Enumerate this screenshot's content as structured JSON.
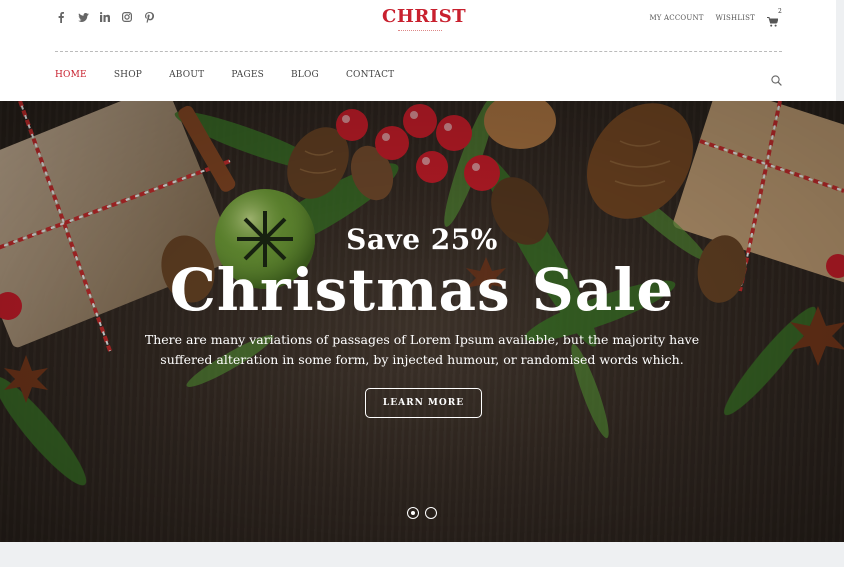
{
  "header": {
    "social_icons": [
      "facebook-icon",
      "twitter-icon",
      "linkedin-icon",
      "instagram-icon",
      "pinterest-icon"
    ],
    "logo_text": "CHRIST",
    "account_links": [
      "MY ACCOUNT",
      "WISHLIST"
    ],
    "cart_count": "2"
  },
  "nav": {
    "items": [
      "HOME",
      "SHOP",
      "ABOUT",
      "PAGES",
      "BLOG",
      "CONTACT"
    ],
    "active": "HOME"
  },
  "hero": {
    "subtitle": "Save 25%",
    "title": "Christmas Sale",
    "description": "There are many variations of passages of Lorem Ipsum available, but the majority have suffered alteration in some form, by injected humour, or randomised words which.",
    "button_label": "LEARN MORE",
    "slides": 2,
    "active_slide": 1
  },
  "colors": {
    "accent": "#c8202e",
    "hero_bg": "#3a2f27",
    "footer_band": "#eef0f2"
  }
}
